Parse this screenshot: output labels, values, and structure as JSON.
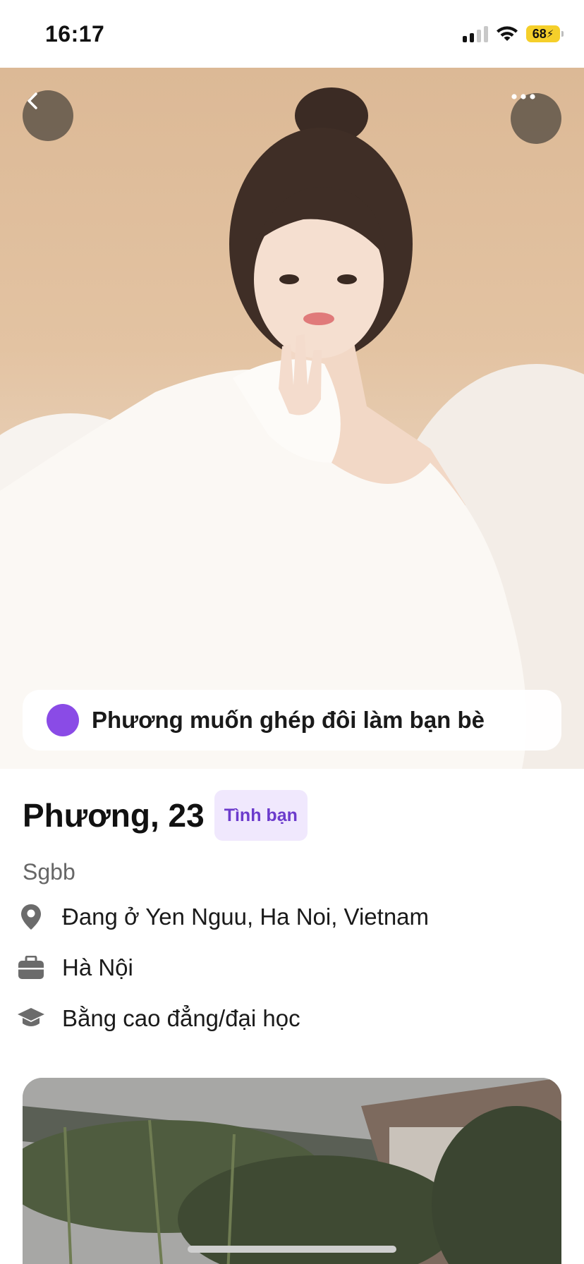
{
  "status_bar": {
    "time": "16:17",
    "battery": "68"
  },
  "profile": {
    "name_age": "Phương, 23",
    "tag": "Tình bạn",
    "bio": "Sgbb",
    "match_message": "Phương muốn ghép đôi làm bạn bè",
    "details": [
      {
        "icon": "location-pin-icon",
        "text": "Đang ở Yen Nguu, Ha Noi, Vietnam"
      },
      {
        "icon": "briefcase-icon",
        "text": "Hà Nội"
      },
      {
        "icon": "graduation-cap-icon",
        "text": "Bằng cao đẳng/đại học"
      }
    ]
  },
  "colors": {
    "accent": "#8a4be6",
    "tag_bg": "#f0e8fd",
    "tag_text": "#6c3bcc",
    "battery": "#f5cf2a"
  }
}
